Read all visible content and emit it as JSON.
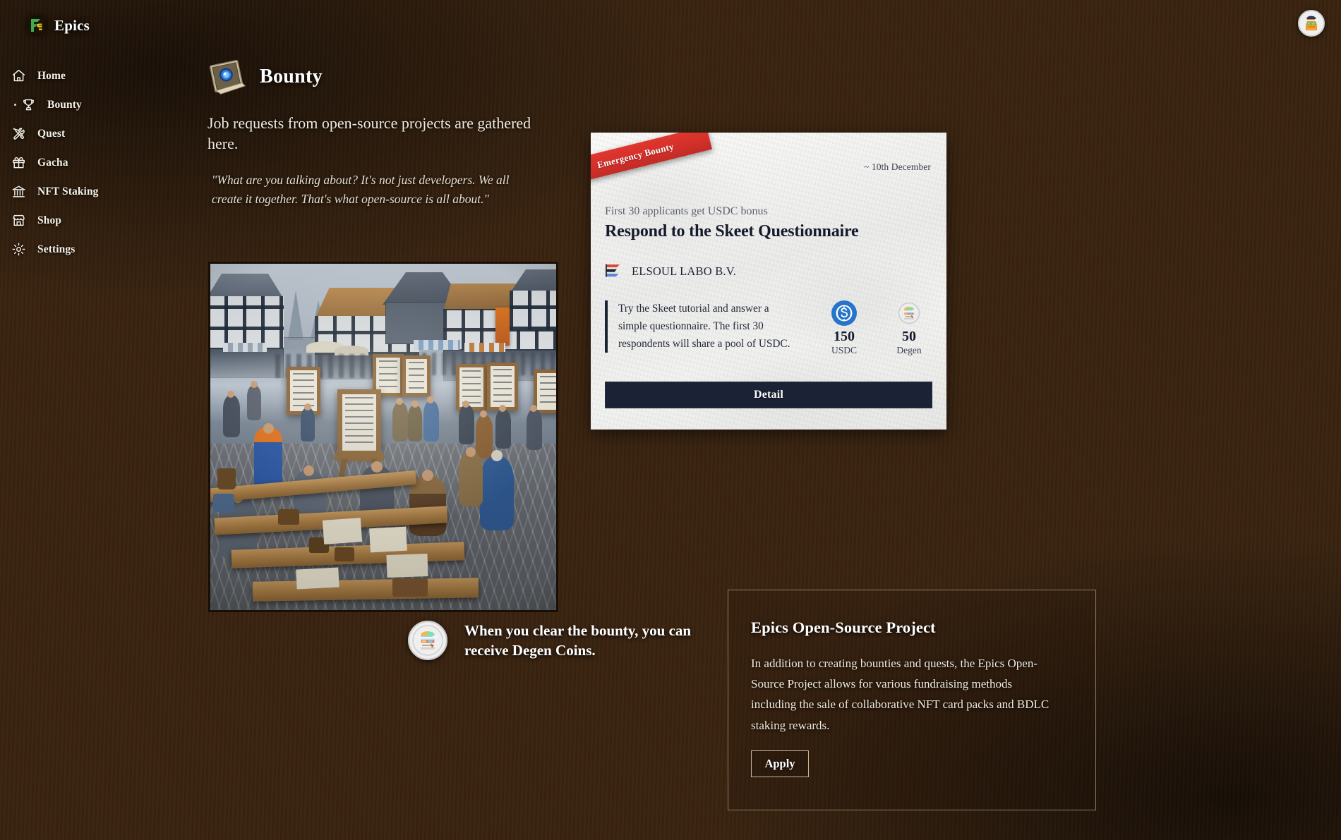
{
  "brand": {
    "name": "Epics",
    "logo_icon": "epics-logo-icon"
  },
  "sidebar": {
    "items": [
      {
        "label": "Home",
        "icon": "home-icon",
        "active": false
      },
      {
        "label": "Bounty",
        "icon": "trophy-icon",
        "active": true
      },
      {
        "label": "Quest",
        "icon": "crossed-tools-icon",
        "active": false
      },
      {
        "label": "Gacha",
        "icon": "gift-icon",
        "active": false
      },
      {
        "label": "NFT Staking",
        "icon": "bank-icon",
        "active": false
      },
      {
        "label": "Shop",
        "icon": "store-icon",
        "active": false
      },
      {
        "label": "Settings",
        "icon": "gear-icon",
        "active": false
      }
    ]
  },
  "header": {
    "avatar_icon": "user-avatar-pixel-icon"
  },
  "page": {
    "title": "Bounty",
    "icon": "bounty-scroll-gem-icon",
    "intro": "Job requests from open-source projects are gathered here.",
    "quote": "\"What are you talking about? It's not just developers. We all create it together. That's what open-source is all about.\"",
    "illustration_alt": "medieval-market-guild-board-illustration",
    "degen_note": {
      "coin_icon": "degen-coin-icon",
      "text": "When you clear the bounty, you can receive Degen Coins."
    }
  },
  "bounty_card": {
    "ribbon": "Emergency Bounty",
    "date": "~ 10th December",
    "subtitle": "First 30 applicants get USDC bonus",
    "title": "Respond to the Skeet Questionnaire",
    "org": {
      "name": "ELSOUL LABO B.V.",
      "logo_icon": "elsoul-labo-flag-icon"
    },
    "description": "Try the Skeet tutorial and answer a simple questionnaire. The first 30 respondents will share a pool of USDC.",
    "rewards": [
      {
        "amount": "150",
        "name": "USDC",
        "icon": "usdc-coin-icon",
        "color": "#2775ca"
      },
      {
        "amount": "50",
        "name": "Degen",
        "icon": "degen-coin-icon",
        "color": "#d9d9d9"
      }
    ],
    "detail_label": "Detail"
  },
  "promo": {
    "title": "Epics Open-Source Project",
    "body": "In addition to creating bounties and quests, the Epics Open-Source Project allows for various fundraising methods including the sale of collaborative NFT card packs and BDLC staking rewards.",
    "apply_label": "Apply"
  },
  "colors": {
    "wood_bg": "#3a2411",
    "card_bg": "#f4f4f2",
    "ribbon_red": "#d4302a",
    "navy": "#1b2236",
    "usdc_blue": "#2775ca",
    "promo_border": "#8f7a5e"
  }
}
